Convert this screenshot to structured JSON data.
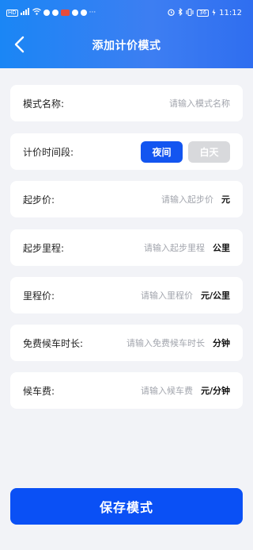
{
  "status_bar": {
    "left_glyphs": "HD",
    "more": "···",
    "battery": "36",
    "time": "11:12"
  },
  "nav": {
    "title": "添加计价模式"
  },
  "form": {
    "mode_name": {
      "label": "模式名称:",
      "placeholder": "请输入模式名称"
    },
    "time_period": {
      "label": "计价时间段:",
      "options": [
        "夜间",
        "白天"
      ],
      "selected": "夜间"
    },
    "start_price": {
      "label": "起步价:",
      "placeholder": "请输入起步价",
      "unit": "元"
    },
    "start_distance": {
      "label": "起步里程:",
      "placeholder": "请输入起步里程",
      "unit": "公里"
    },
    "distance_price": {
      "label": "里程价:",
      "placeholder": "请输入里程价",
      "unit": "元/公里"
    },
    "free_wait": {
      "label": "免费候车时长:",
      "placeholder": "请输入免费候车时长",
      "unit": "分钟"
    },
    "wait_fee": {
      "label": "候车费:",
      "placeholder": "请输入候车费",
      "unit": "元/分钟"
    }
  },
  "save_button": "保存模式",
  "colors": {
    "primary": "#1355f0",
    "header_gradient_start": "#1a86f5",
    "background": "#f2f3f7"
  }
}
